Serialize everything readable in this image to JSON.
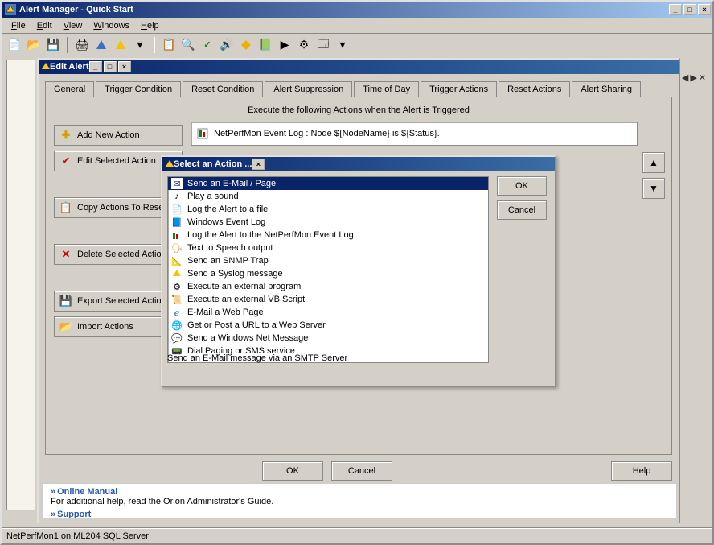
{
  "window_title": "Alert Manager - Quick Start",
  "menus": [
    "File",
    "Edit",
    "View",
    "Windows",
    "Help"
  ],
  "edit_alert": {
    "title": "Edit Alert",
    "tabs": [
      "General",
      "Trigger Condition",
      "Reset Condition",
      "Alert Suppression",
      "Time of Day",
      "Trigger Actions",
      "Reset Actions",
      "Alert Sharing"
    ],
    "active_tab": 5,
    "intro": "Execute the following Actions when the Alert is Triggered",
    "buttons": {
      "add": "Add New Action",
      "edit": "Edit Selected Action",
      "copy": "Copy Actions To Reset",
      "delete": "Delete Selected Actions",
      "export": "Export Selected Actions",
      "import": "Import Actions"
    },
    "current_action": "NetPerfMon Event Log : Node ${NodeName} is ${Status}.",
    "ok": "OK",
    "cancel": "Cancel",
    "help": "Help"
  },
  "select_action": {
    "title": "Select an Action ...",
    "items": [
      {
        "icon": "mail-icon",
        "label": "Send an E-Mail / Page"
      },
      {
        "icon": "sound-icon",
        "label": "Play a sound"
      },
      {
        "icon": "file-icon",
        "label": "Log the Alert to a file"
      },
      {
        "icon": "eventlog-icon",
        "label": "Windows Event Log"
      },
      {
        "icon": "npm-icon",
        "label": "Log the Alert to the NetPerfMon Event Log"
      },
      {
        "icon": "tts-icon",
        "label": "Text to Speech output"
      },
      {
        "icon": "snmp-icon",
        "label": "Send an SNMP Trap"
      },
      {
        "icon": "syslog-icon",
        "label": "Send a Syslog message"
      },
      {
        "icon": "gear-icon",
        "label": "Execute an external program"
      },
      {
        "icon": "vb-icon",
        "label": "Execute an external VB Script"
      },
      {
        "icon": "ie-icon",
        "label": "E-Mail a Web Page"
      },
      {
        "icon": "url-icon",
        "label": "Get or Post a URL to a Web Server"
      },
      {
        "icon": "netmsg-icon",
        "label": "Send a Windows Net Message"
      },
      {
        "icon": "pager-icon",
        "label": "Dial Paging or SMS service"
      }
    ],
    "selected": 0,
    "hint": "Send an E-Mail message via an SMTP Server",
    "ok": "OK",
    "cancel": "Cancel"
  },
  "below": {
    "heading": "Online Manual",
    "text": "For additional help, read the Orion Administrator's Guide.",
    "next": "Support"
  },
  "statusbar": "NetPerfMon1 on ML204 SQL Server"
}
